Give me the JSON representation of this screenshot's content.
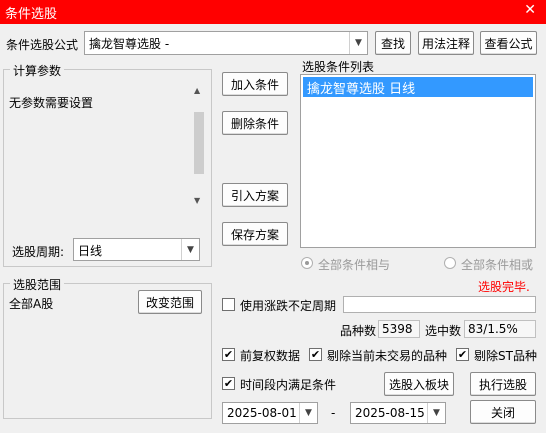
{
  "window": {
    "title": "条件选股",
    "close_glyph": "✕"
  },
  "formula_row": {
    "label": "条件选股公式",
    "value": "擒龙智尊选股 -",
    "btn_find": "查找",
    "btn_usage": "用法注释",
    "btn_view": "查看公式"
  },
  "params": {
    "group_title": "计算参数",
    "note": "无参数需要设置",
    "period_label": "选股周期:",
    "period_value": "日线"
  },
  "actions": {
    "add": "加入条件",
    "delete": "删除条件",
    "import": "引入方案",
    "save": "保存方案"
  },
  "conditions": {
    "list_label": "选股条件列表",
    "items": [
      "擒龙智尊选股  日线"
    ],
    "radio_all_and": "全部条件相与",
    "radio_all_or": "全部条件相或",
    "status": "选股完毕."
  },
  "scope": {
    "group_title": "选股范围",
    "value": "全部A股",
    "btn_change": "改变范围"
  },
  "options": {
    "use_period_label": "使用涨跌不定周期",
    "count_label": "品种数",
    "count_value": "5398",
    "selected_label": "选中数",
    "selected_value": "83/1.5%",
    "check_fq": "前复权数据",
    "check_untraded": "剔除当前未交易的品种",
    "check_st": "剔除ST品种",
    "check_period": "时间段内满足条件",
    "btn_to_board": "选股入板块",
    "btn_run": "执行选股",
    "date_from": "2025-08-01",
    "date_sep": "-",
    "date_to": "2025-08-15",
    "btn_close": "关闭"
  },
  "colors": {
    "title_bar": "#ff0000",
    "selection": "#3399ff",
    "status": "#ff0000"
  },
  "icons": {
    "check": "✔",
    "dropdown": "▼"
  }
}
